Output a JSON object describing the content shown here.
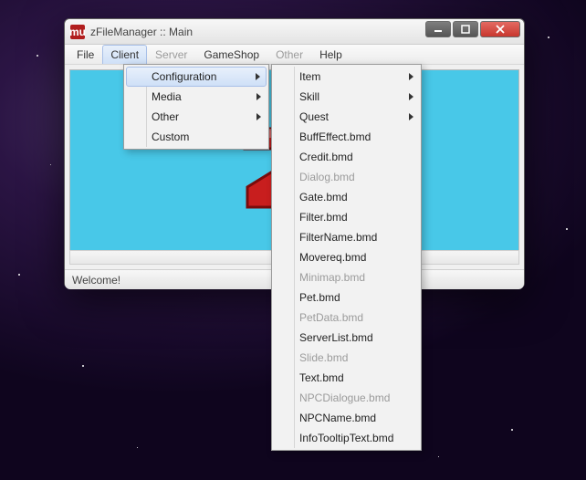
{
  "colors": {
    "accent_border": "#a8c0e8",
    "accent_fill_top": "#e8f0fb",
    "accent_fill_bot": "#cfe0f7",
    "close_red": "#c8372e",
    "canvas_blue": "#48c8e8"
  },
  "window": {
    "icon_text": "mu",
    "title": "zFileManager :: Main",
    "buttons": {
      "min": "minimize",
      "max": "maximize",
      "close": "close"
    }
  },
  "menubar": {
    "items": [
      {
        "label": "File",
        "disabled": false,
        "open": false
      },
      {
        "label": "Client",
        "disabled": false,
        "open": true
      },
      {
        "label": "Server",
        "disabled": true,
        "open": false
      },
      {
        "label": "GameShop",
        "disabled": false,
        "open": false
      },
      {
        "label": "Other",
        "disabled": true,
        "open": false
      },
      {
        "label": "Help",
        "disabled": false,
        "open": false
      }
    ]
  },
  "statusbar": {
    "text": "Welcome!"
  },
  "dropdown_client": {
    "items": [
      {
        "label": "Configuration",
        "submenu": true,
        "disabled": false,
        "hover": true
      },
      {
        "label": "Media",
        "submenu": true,
        "disabled": false,
        "hover": false
      },
      {
        "label": "Other",
        "submenu": true,
        "disabled": false,
        "hover": false
      },
      {
        "label": "Custom",
        "submenu": false,
        "disabled": false,
        "hover": false
      }
    ]
  },
  "dropdown_config": {
    "items": [
      {
        "label": "Item",
        "submenu": true,
        "disabled": false
      },
      {
        "label": "Skill",
        "submenu": true,
        "disabled": false
      },
      {
        "label": "Quest",
        "submenu": true,
        "disabled": false
      },
      {
        "label": "BuffEffect.bmd",
        "submenu": false,
        "disabled": false
      },
      {
        "label": "Credit.bmd",
        "submenu": false,
        "disabled": false
      },
      {
        "label": "Dialog.bmd",
        "submenu": false,
        "disabled": true
      },
      {
        "label": "Gate.bmd",
        "submenu": false,
        "disabled": false
      },
      {
        "label": "Filter.bmd",
        "submenu": false,
        "disabled": false
      },
      {
        "label": "FilterName.bmd",
        "submenu": false,
        "disabled": false
      },
      {
        "label": "Movereq.bmd",
        "submenu": false,
        "disabled": false
      },
      {
        "label": "Minimap.bmd",
        "submenu": false,
        "disabled": true
      },
      {
        "label": "Pet.bmd",
        "submenu": false,
        "disabled": false
      },
      {
        "label": "PetData.bmd",
        "submenu": false,
        "disabled": true
      },
      {
        "label": "ServerList.bmd",
        "submenu": false,
        "disabled": false
      },
      {
        "label": "Slide.bmd",
        "submenu": false,
        "disabled": true
      },
      {
        "label": "Text.bmd",
        "submenu": false,
        "disabled": false
      },
      {
        "label": "NPCDialogue.bmd",
        "submenu": false,
        "disabled": true
      },
      {
        "label": "NPCName.bmd",
        "submenu": false,
        "disabled": false
      },
      {
        "label": "InfoTooltipText.bmd",
        "submenu": false,
        "disabled": false
      }
    ]
  }
}
